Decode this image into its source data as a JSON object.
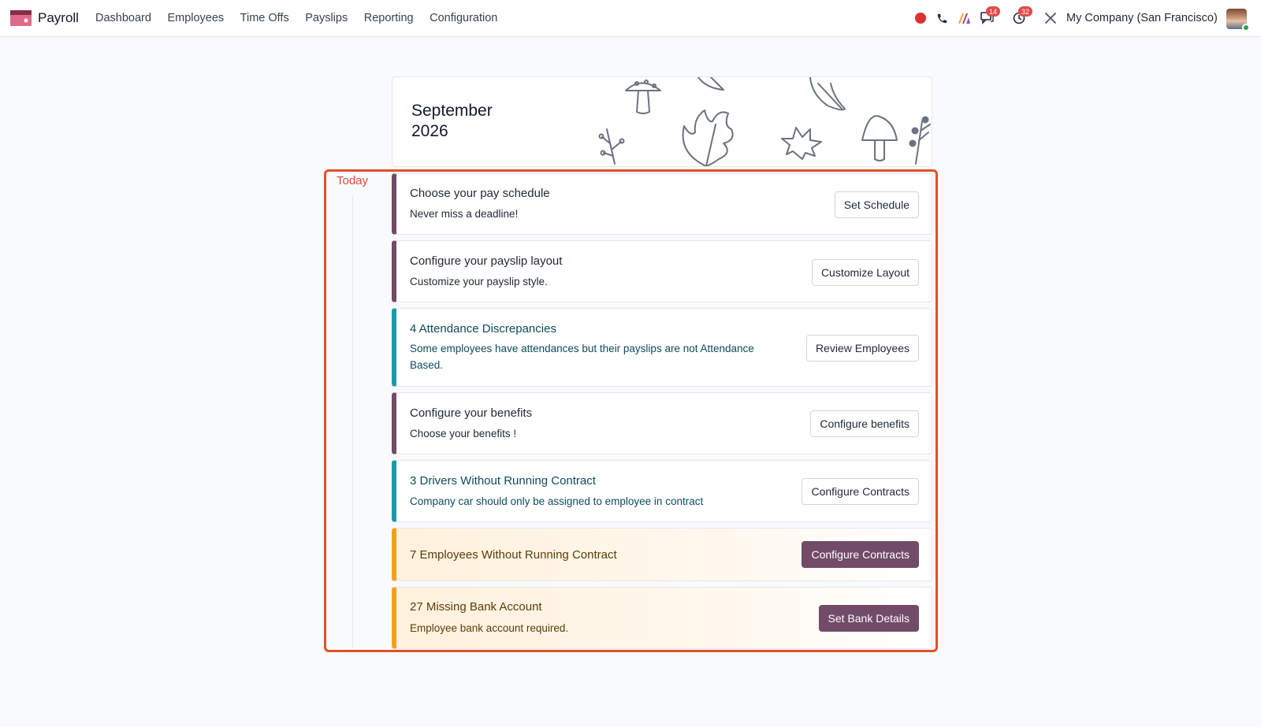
{
  "navbar": {
    "app_name": "Payroll",
    "menu": [
      "Dashboard",
      "Employees",
      "Time Offs",
      "Payslips",
      "Reporting",
      "Configuration"
    ],
    "messages_badge": "14",
    "activities_badge": "32",
    "company": "My Company (San Francisco)",
    "icons": [
      "record-dot-icon",
      "phone-icon",
      "ai-icon",
      "chat-icon",
      "clock-icon",
      "tools-icon"
    ]
  },
  "header": {
    "month": "September",
    "year": "2026"
  },
  "timeline": {
    "today_label": "Today",
    "tasks": [
      {
        "title": "Choose your pay schedule",
        "description": "Never miss a deadline!",
        "button": "Set Schedule",
        "style": "default"
      },
      {
        "title": "Configure your payslip layout",
        "description": "Customize your payslip style.",
        "button": "Customize Layout",
        "style": "default"
      },
      {
        "title": "4 Attendance Discrepancies",
        "description": "Some employees have attendances but their payslips are not Attendance Based.",
        "button": "Review Employees",
        "style": "info"
      },
      {
        "title": "Configure your benefits",
        "description": "Choose your benefits !",
        "button": "Configure benefits",
        "style": "default"
      },
      {
        "title": "3 Drivers Without Running Contract",
        "description": "Company car should only be assigned to employee in contract",
        "button": "Configure Contracts",
        "style": "info"
      },
      {
        "title": "7 Employees Without Running Contract",
        "description": "",
        "button": "Configure Contracts",
        "style": "warning-primary"
      },
      {
        "title": "27 Missing Bank Account",
        "description": "Employee bank account required.",
        "button": "Set Bank Details",
        "style": "warning-primary"
      }
    ]
  },
  "colors": {
    "brand": "#714b67",
    "info": "#1b9aaa",
    "warning": "#f0a020",
    "highlight": "#e1502b"
  }
}
